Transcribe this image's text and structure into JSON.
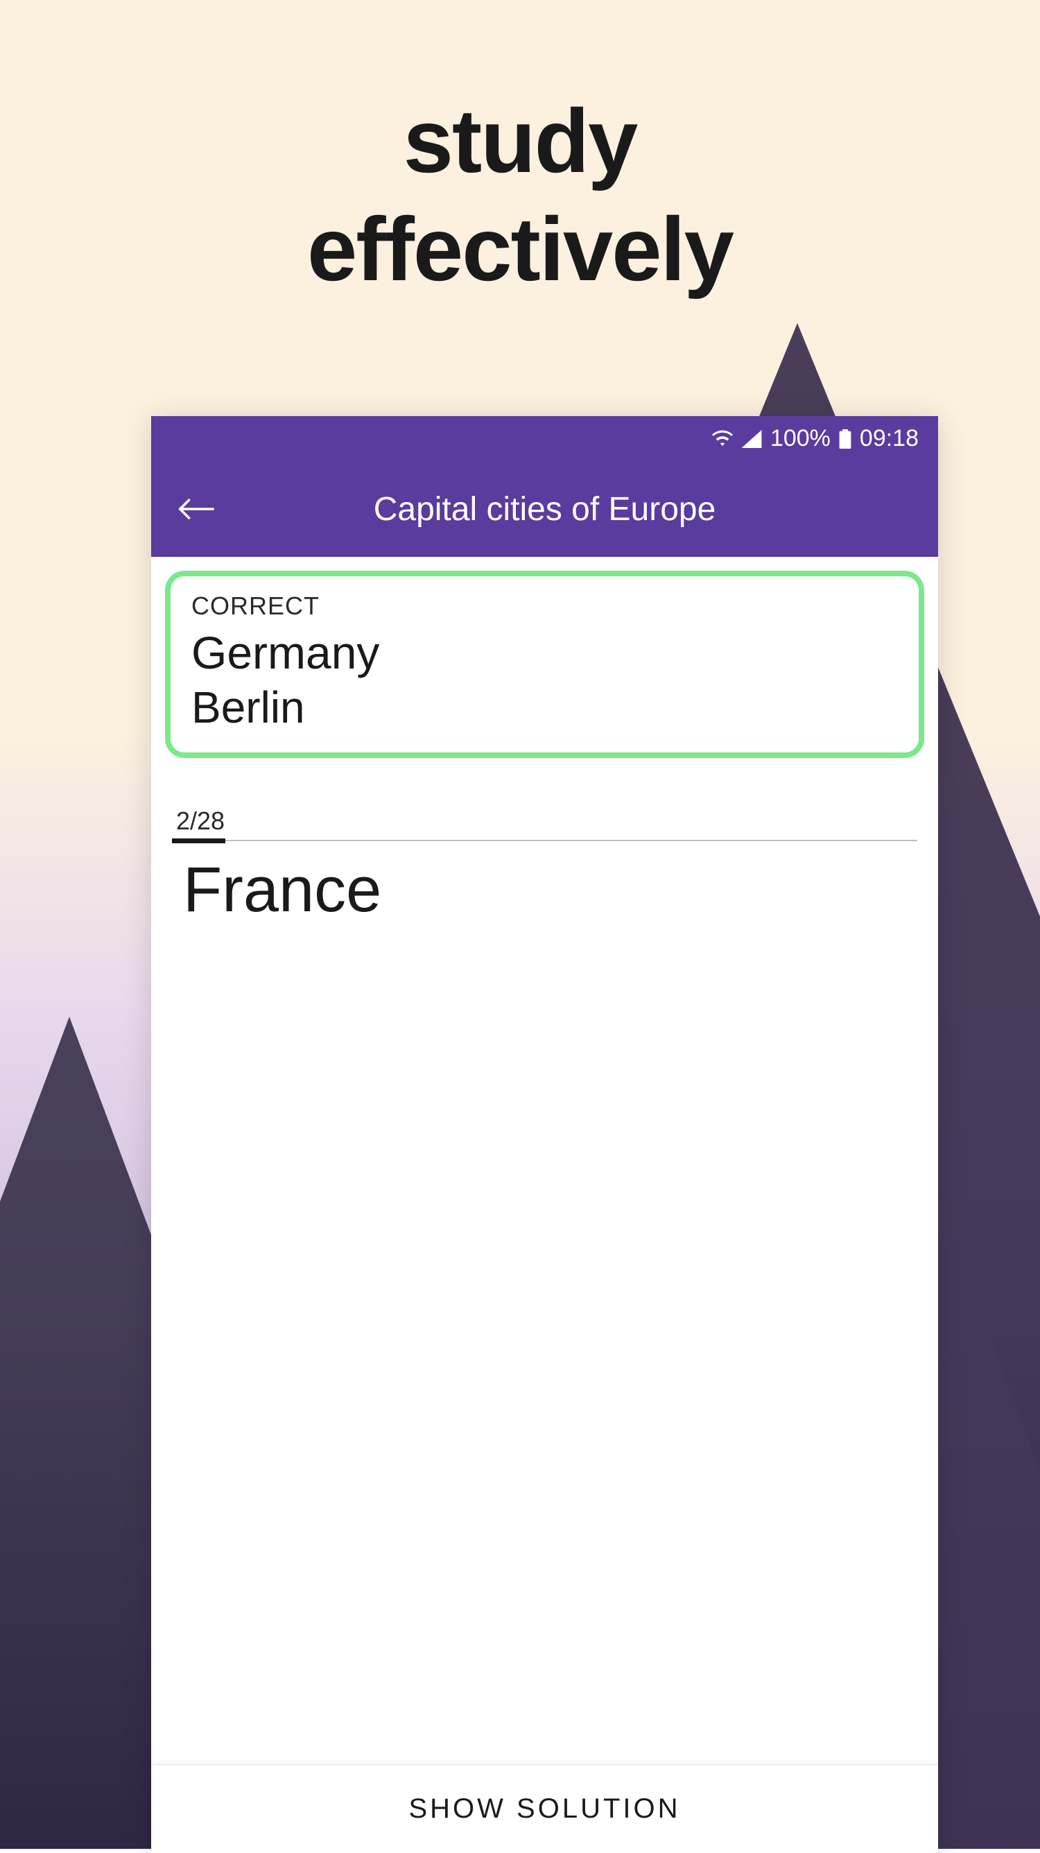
{
  "headline": {
    "line1": "study",
    "line2": "effectively"
  },
  "statusBar": {
    "battery": "100%",
    "time": "09:18"
  },
  "appBar": {
    "title": "Capital cities of Europe"
  },
  "correctCard": {
    "label": "CORRECT",
    "term": "Germany",
    "answer": "Berlin"
  },
  "progress": {
    "label": "2/28",
    "current": 2,
    "total": 28
  },
  "currentCard": {
    "term": "France"
  },
  "bottomBar": {
    "buttonLabel": "SHOW SOLUTION"
  },
  "colors": {
    "accent": "#5a3b9e",
    "correct": "#7ce88b"
  }
}
